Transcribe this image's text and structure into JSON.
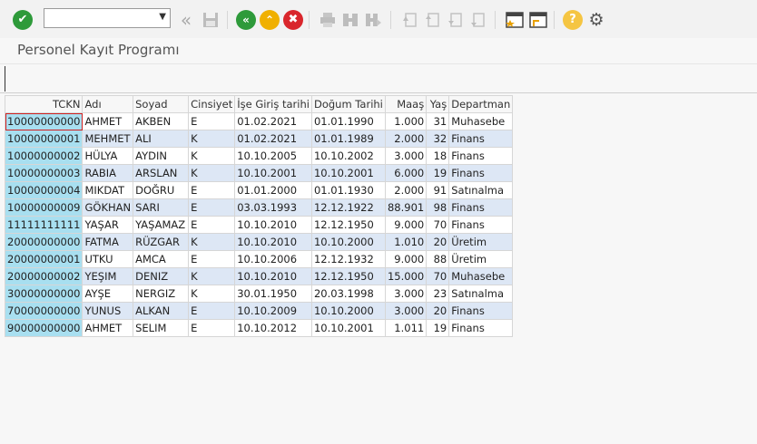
{
  "toolbar": {
    "command_field_value": "",
    "icons": [
      "enter-check-icon",
      "history-back-icon",
      "save-icon",
      "back-icon",
      "exit-icon",
      "cancel-icon",
      "print-icon",
      "find-icon",
      "find-next-icon",
      "first-page-icon",
      "previous-page-icon",
      "next-page-icon",
      "last-page-icon",
      "new-session-icon",
      "create-shortcut-icon",
      "help-icon",
      "settings-gear-icon"
    ]
  },
  "screen": {
    "title": "Personel Kayıt Programı"
  },
  "table": {
    "columns": [
      "TCKN",
      "Adı",
      "Soyad",
      "Cinsiyet",
      "İşe Giriş tarihi",
      "Doğum Tarihi",
      "Maaş",
      "Yaş",
      "Departman"
    ],
    "rows": [
      [
        "10000000000",
        "AHMET",
        "AKBEN",
        "E",
        "01.02.2021",
        "01.01.1990",
        "1.000",
        "31",
        "Muhasebe"
      ],
      [
        "10000000001",
        "MEHMET",
        "ALI",
        "K",
        "01.02.2021",
        "01.01.1989",
        "2.000",
        "32",
        "Finans"
      ],
      [
        "10000000002",
        "HÜLYA",
        "AYDIN",
        "K",
        "10.10.2005",
        "10.10.2002",
        "3.000",
        "18",
        "Finans"
      ],
      [
        "10000000003",
        "RABIA",
        "ARSLAN",
        "K",
        "10.10.2001",
        "10.10.2001",
        "6.000",
        "19",
        "Finans"
      ],
      [
        "10000000004",
        "MIKDAT",
        "DOĞRU",
        "E",
        "01.01.2000",
        "01.01.1930",
        "2.000",
        "91",
        "Satınalma"
      ],
      [
        "10000000009",
        "GÖKHAN",
        "SARI",
        "E",
        "03.03.1993",
        "12.12.1922",
        "88.901",
        "98",
        "Finans"
      ],
      [
        "11111111111",
        "YAŞAR",
        "YAŞAMAZ",
        "E",
        "10.10.2010",
        "12.12.1950",
        "9.000",
        "70",
        "Finans"
      ],
      [
        "20000000000",
        "FATMA",
        "RÜZGAR",
        "K",
        "10.10.2010",
        "10.10.2000",
        "1.010",
        "20",
        "Üretim"
      ],
      [
        "20000000001",
        "UTKU",
        "AMCA",
        "E",
        "10.10.2006",
        "12.12.1932",
        "9.000",
        "88",
        "Üretim"
      ],
      [
        "20000000002",
        "YEŞIM",
        "DENIZ",
        "K",
        "10.10.2010",
        "12.12.1950",
        "15.000",
        "70",
        "Muhasebe"
      ],
      [
        "30000000000",
        "AYŞE",
        "NERGIZ",
        "K",
        "30.01.1950",
        "20.03.1998",
        "3.000",
        "23",
        "Satınalma"
      ],
      [
        "70000000000",
        "YUNUS",
        "ALKAN",
        "E",
        "10.10.2009",
        "10.10.2000",
        "3.000",
        "20",
        "Finans"
      ],
      [
        "90000000000",
        "AHMET",
        "SELIM",
        "E",
        "10.10.2012",
        "10.10.2001",
        "1.011",
        "19",
        "Finans"
      ]
    ]
  }
}
